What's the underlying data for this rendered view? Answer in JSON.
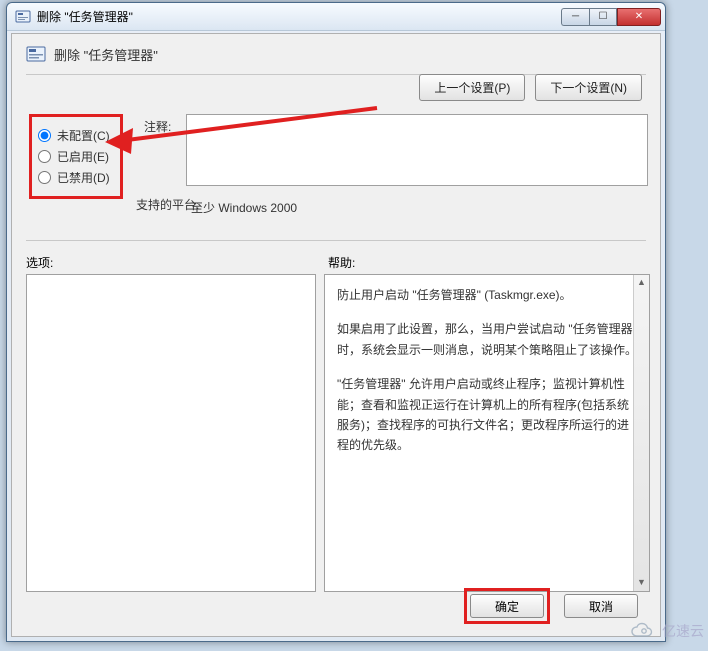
{
  "window": {
    "title": "删除 \"任务管理器\""
  },
  "header": {
    "title": "删除 \"任务管理器\""
  },
  "nav": {
    "prev": "上一个设置(P)",
    "next": "下一个设置(N)"
  },
  "radios": {
    "not_configured": "未配置(C)",
    "enabled": "已启用(E)",
    "disabled": "已禁用(D)"
  },
  "labels": {
    "comment": "注释:",
    "platform": "支持的平台:",
    "options": "选项:",
    "help": "帮助:"
  },
  "fields": {
    "comment_value": "",
    "platform_value": "至少 Windows 2000"
  },
  "help": {
    "p1": "防止用户启动 \"任务管理器\" (Taskmgr.exe)。",
    "p2": "如果启用了此设置，那么，当用户尝试启动 \"任务管理器\" 时，系统会显示一则消息，说明某个策略阻止了该操作。",
    "p3": "\"任务管理器\" 允许用户启动或终止程序；监视计算机性能；查看和监视正运行在计算机上的所有程序(包括系统服务)；查找程序的可执行文件名；更改程序所运行的进程的优先级。"
  },
  "buttons": {
    "ok": "确定",
    "cancel": "取消"
  },
  "watermark": {
    "text": "亿速云"
  }
}
